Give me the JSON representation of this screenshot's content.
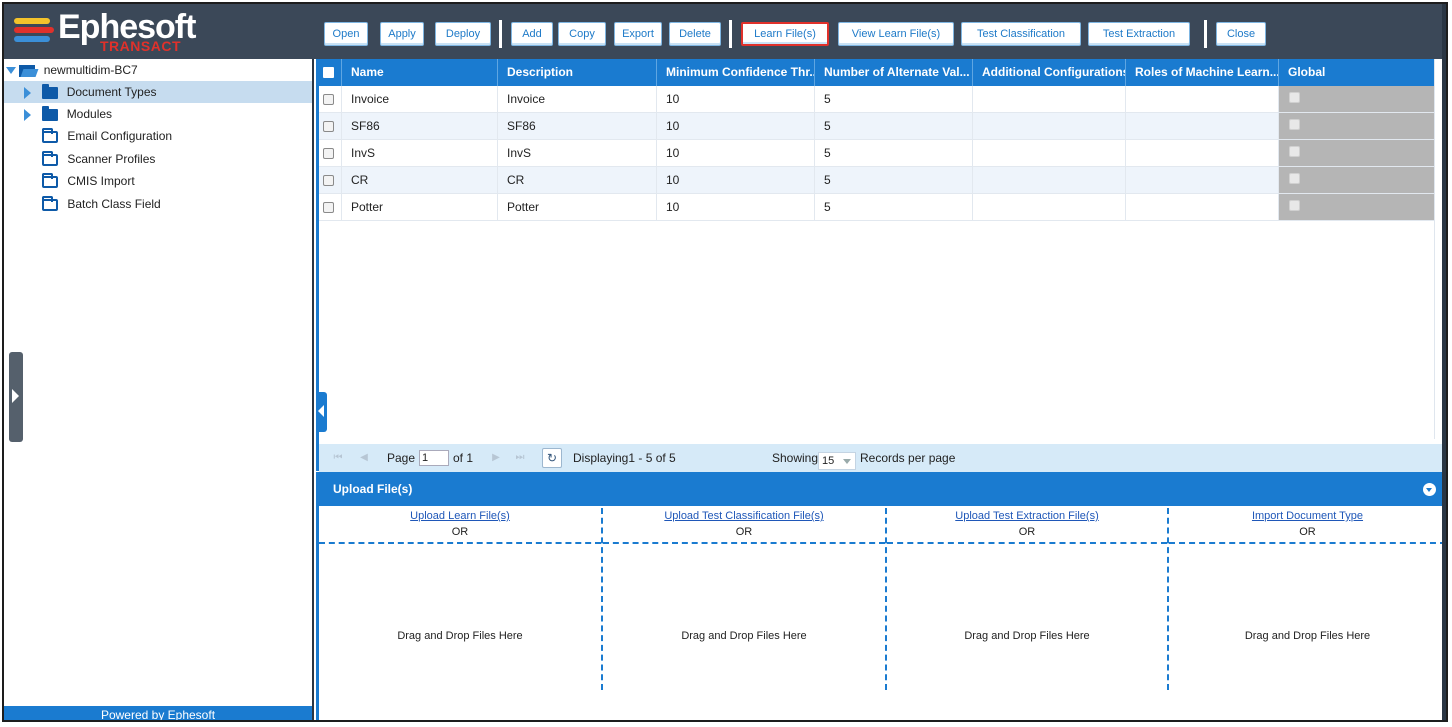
{
  "app": {
    "logo_word": "Ephesoft",
    "logo_sub": "TRANSACT",
    "powered_by": "Powered by Ephesoft"
  },
  "toolbar": {
    "buttons": [
      "Open",
      "Apply",
      "Deploy",
      "Add",
      "Copy",
      "Export",
      "Delete",
      "Learn File(s)",
      "View Learn File(s)",
      "Test Classification",
      "Test Extraction",
      "Close"
    ],
    "active": "Learn File(s)"
  },
  "sidebar": {
    "root": "newmultidim-BC7",
    "items": [
      {
        "label": "Document Types",
        "expandable": true,
        "selected": true
      },
      {
        "label": "Modules",
        "expandable": true,
        "selected": false
      },
      {
        "label": "Email Configuration",
        "expandable": false,
        "selected": false
      },
      {
        "label": "Scanner Profiles",
        "expandable": false,
        "selected": false
      },
      {
        "label": "CMIS Import",
        "expandable": false,
        "selected": false
      },
      {
        "label": "Batch Class Field",
        "expandable": false,
        "selected": false
      }
    ]
  },
  "grid": {
    "columns": [
      "Name",
      "Description",
      "Minimum Confidence Thr...",
      "Number of Alternate Val...",
      "Additional Configurations",
      "Roles of Machine Learn...",
      "Global"
    ],
    "rows": [
      {
        "name": "Invoice",
        "description": "Invoice",
        "min_conf": "10",
        "num_alt": "5",
        "additional": "",
        "roles": ""
      },
      {
        "name": "SF86",
        "description": "SF86",
        "min_conf": "10",
        "num_alt": "5",
        "additional": "",
        "roles": ""
      },
      {
        "name": "InvS",
        "description": "InvS",
        "min_conf": "10",
        "num_alt": "5",
        "additional": "",
        "roles": ""
      },
      {
        "name": "CR",
        "description": "CR",
        "min_conf": "10",
        "num_alt": "5",
        "additional": "",
        "roles": ""
      },
      {
        "name": "Potter",
        "description": "Potter",
        "min_conf": "10",
        "num_alt": "5",
        "additional": "",
        "roles": ""
      }
    ]
  },
  "pager": {
    "page_label": "Page",
    "page_value": "1",
    "of_label": "of 1",
    "displaying": "Displaying1 - 5 of 5",
    "showing_label": "Showing",
    "records_per_page": "15",
    "records_label": "Records per page"
  },
  "upload": {
    "title": "Upload File(s)",
    "columns": [
      {
        "link": "Upload Learn File(s)",
        "or": "OR",
        "drop": "Drag and Drop Files Here"
      },
      {
        "link": "Upload Test Classification File(s)",
        "or": "OR",
        "drop": "Drag and Drop Files Here"
      },
      {
        "link": "Upload Test Extraction File(s)",
        "or": "OR",
        "drop": "Drag and Drop Files Here"
      },
      {
        "link": "Import Document Type",
        "or": "OR",
        "drop": "Drag and Drop Files Here"
      }
    ]
  },
  "colors": {
    "accent": "#1a7bd0",
    "topbar": "#3b4858",
    "active_outline": "#e0312b",
    "selected_row": "#c6dcef"
  }
}
